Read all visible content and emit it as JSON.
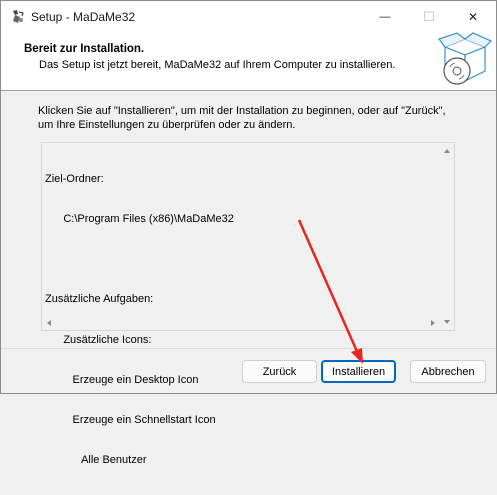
{
  "window": {
    "title": "Setup - MaDaMe32"
  },
  "titlebar": {
    "min_glyph": "—",
    "max_glyph": "☐",
    "close_glyph": "✕"
  },
  "header": {
    "title": "Bereit zur Installation.",
    "subtitle": "Das Setup ist jetzt bereit, MaDaMe32 auf Ihrem Computer zu installieren."
  },
  "intro": {
    "line1": "Klicken Sie auf \"Installieren\", um mit der Installation zu beginnen, oder auf \"Zurück\",",
    "line2": "um Ihre Einstellungen zu überprüfen oder zu ändern."
  },
  "memo": {
    "lines": [
      "Ziel-Ordner:",
      "      C:\\Program Files (x86)\\MaDaMe32",
      "",
      "Zusätzliche Aufgaben:",
      "      Zusätzliche Icons:",
      "         Erzeuge ein Desktop Icon",
      "         Erzeuge ein Schnellstart Icon",
      "            Alle Benutzer"
    ]
  },
  "buttons": {
    "back": "Zurück",
    "install": "Installieren",
    "cancel": "Abbrechen"
  },
  "annotation": {
    "color": "#e8261f"
  },
  "icons": {
    "app": "setup-app-icon",
    "header": "software-box-cd-icon"
  }
}
